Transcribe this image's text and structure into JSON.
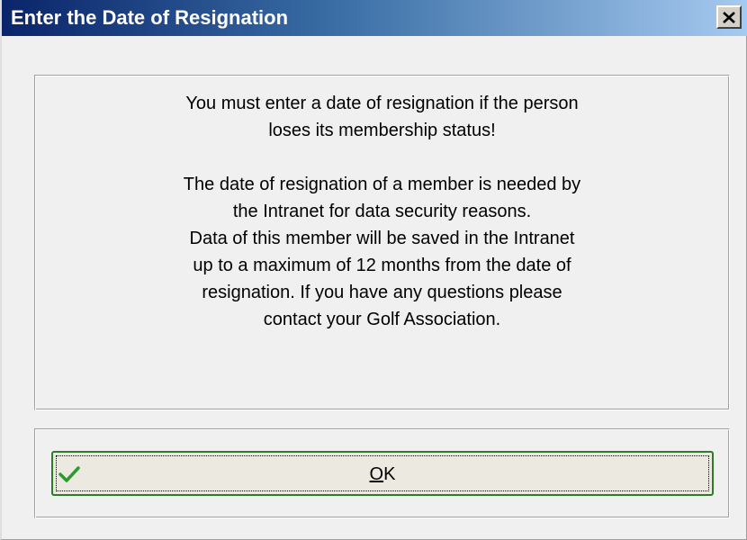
{
  "window": {
    "title": "Enter the Date of Resignation",
    "close_icon": "close-icon"
  },
  "message": {
    "paragraph1": [
      "You must enter a date of resignation if the person",
      "loses its membership status!"
    ],
    "paragraph2": [
      "The date of resignation of a member is needed by",
      "the Intranet for data security reasons.",
      "Data of this member will be saved in the Intranet",
      "up to a maximum of 12 months from the date of",
      "resignation. If you have any questions please",
      "contact your Golf Association."
    ]
  },
  "ok_button": {
    "label_accel": "O",
    "label_rest": "K",
    "icon": "checkmark-icon",
    "icon_color": "#2e9a2e"
  },
  "colors": {
    "titlebar_start": "#0a246a",
    "titlebar_end": "#a6caf0",
    "dialog_bg": "#f0f0f0"
  }
}
